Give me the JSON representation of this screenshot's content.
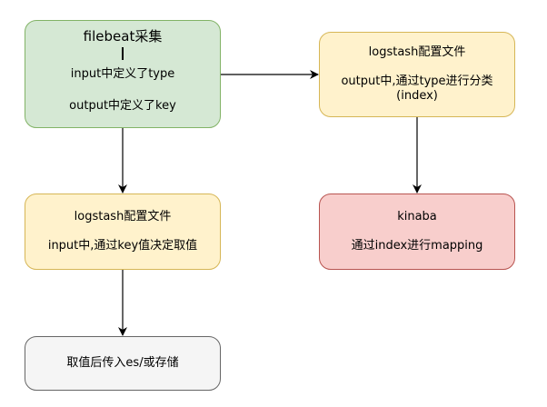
{
  "colors": {
    "green_fill": "#d5e8d4",
    "green_stroke": "#82b366",
    "yellow_fill": "#fff2cc",
    "yellow_stroke": "#d6b656",
    "red_fill": "#f8cecc",
    "red_stroke": "#b85450",
    "gray_fill": "#f5f5f5",
    "gray_stroke": "#666666",
    "edge": "#000000"
  },
  "nodes": {
    "filebeat": {
      "title": "filebeat采集",
      "line1": "input中定义了type",
      "line2": "output中定义了key"
    },
    "logstash_left": {
      "title": "logstash配置文件",
      "line1": "input中,通过key值决定取值"
    },
    "logstash_right": {
      "title": "logstash配置文件",
      "line1": "output中,通过type进行分类",
      "line2": "(index)"
    },
    "kinaba": {
      "title": "kinaba",
      "line1": "通过index进行mapping"
    },
    "storage": {
      "title": "取值后传入es/或存储"
    }
  }
}
